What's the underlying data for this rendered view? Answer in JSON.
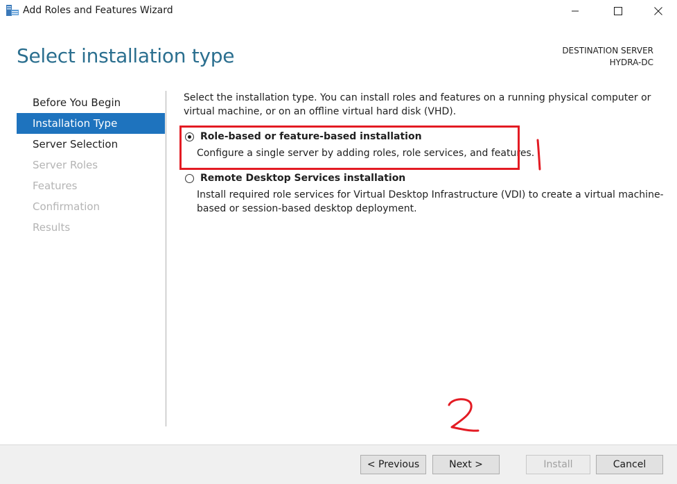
{
  "window": {
    "title": "Add Roles and Features Wizard",
    "controls": [
      "minimize-icon",
      "maximize-icon",
      "close-icon"
    ]
  },
  "header": {
    "page_title": "Select installation type",
    "destination_label": "DESTINATION SERVER",
    "destination_server": "HYDRA-DC"
  },
  "nav": {
    "items": [
      {
        "label": "Before You Begin",
        "state": "normal"
      },
      {
        "label": "Installation Type",
        "state": "active"
      },
      {
        "label": "Server Selection",
        "state": "normal"
      },
      {
        "label": "Server Roles",
        "state": "disabled"
      },
      {
        "label": "Features",
        "state": "disabled"
      },
      {
        "label": "Confirmation",
        "state": "disabled"
      },
      {
        "label": "Results",
        "state": "disabled"
      }
    ]
  },
  "content": {
    "intro": "Select the installation type. You can install roles and features on a running physical computer or virtual machine, or on an offline virtual hard disk (VHD).",
    "options": [
      {
        "title": "Role-based or feature-based installation",
        "description": "Configure a single server by adding roles, role services, and features.",
        "selected": true
      },
      {
        "title": "Remote Desktop Services installation",
        "description": "Install required role services for Virtual Desktop Infrastructure (VDI) to create a virtual machine-based or session-based desktop deployment.",
        "selected": false
      }
    ]
  },
  "annotations": {
    "mark_1": "1",
    "mark_2": "2",
    "color": "#e31b23"
  },
  "footer": {
    "previous": "< Previous",
    "next": "Next >",
    "install": "Install",
    "cancel": "Cancel"
  },
  "colors": {
    "accent": "#1e73be",
    "title": "#2b6f8f",
    "disabled": "#b4b4b4"
  }
}
